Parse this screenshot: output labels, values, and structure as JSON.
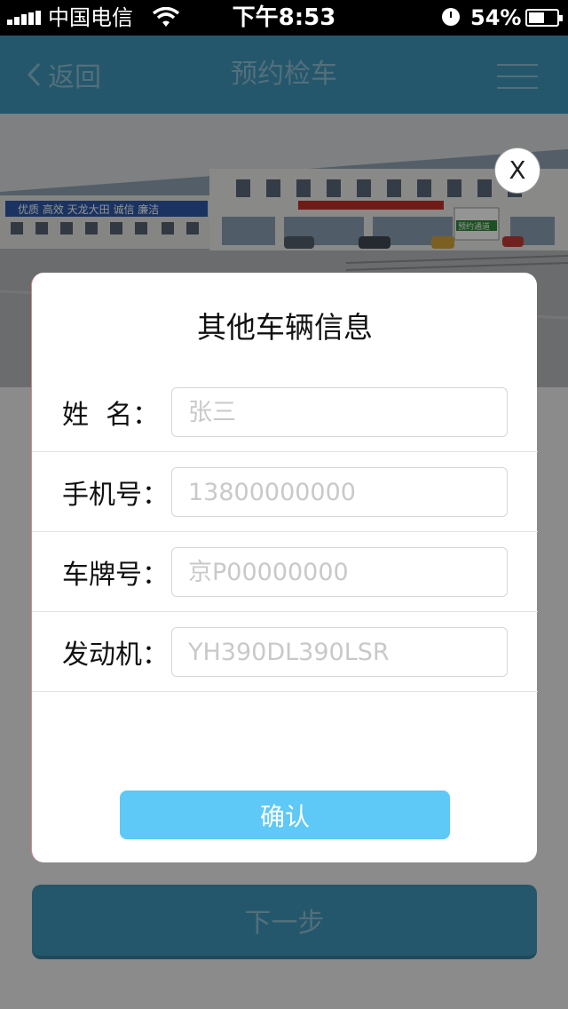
{
  "status_bar": {
    "carrier": "中国电信",
    "time": "下午8:53",
    "battery": "54%"
  },
  "nav": {
    "back_label": "返回",
    "title": "预约检车"
  },
  "hero": {
    "banner_left": "优质  高效  天龙大田  诚信  廉洁",
    "sign": "预约通道"
  },
  "background": {
    "next_label": "下一步"
  },
  "dialog": {
    "close_label": "X",
    "title": "其他车辆信息",
    "fields": [
      {
        "label": "姓  名：",
        "placeholder": "张三"
      },
      {
        "label": "手机号：",
        "placeholder": "13800000000"
      },
      {
        "label": "车牌号：",
        "placeholder": "京P00000000"
      },
      {
        "label": "发动机：",
        "placeholder": "YH390DL390LSR"
      }
    ],
    "confirm_label": "确认"
  }
}
